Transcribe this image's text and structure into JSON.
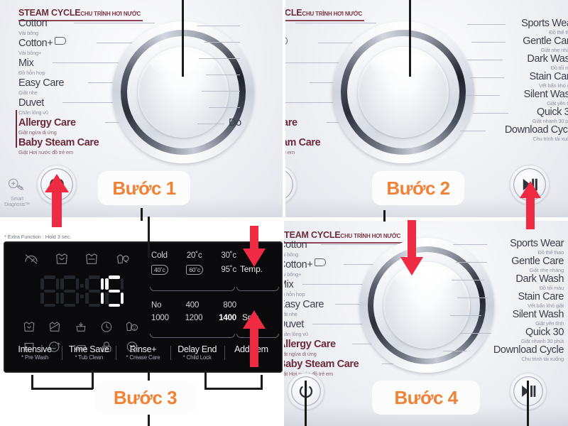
{
  "meta": {
    "subject": "LG front-load washing machine control panel tutorial",
    "accent_orange": "#f08236",
    "arrow_red": "#ee2b42",
    "line_black": "#1a1a1a",
    "maroon": "#6c2b3a"
  },
  "steam_cycle": {
    "en": "STEAM CYCLE",
    "vi": "CHU TRÌNH HƠI NƯỚC"
  },
  "programs_left": [
    {
      "en": "Cotton",
      "vi": "Vải bông",
      "highlight": false,
      "tag": false
    },
    {
      "en": "Cotton+",
      "vi": "Vải bông+",
      "highlight": false,
      "tag": true
    },
    {
      "en": "Mix",
      "vi": "Đồ hỗn hợp",
      "highlight": false,
      "tag": false
    },
    {
      "en": "Easy Care",
      "vi": "Giặt nhẹ",
      "highlight": false,
      "tag": false
    },
    {
      "en": "Duvet",
      "vi": "Chăn lông vũ",
      "highlight": false,
      "tag": false
    },
    {
      "en": "Allergy Care",
      "vi": "Giặt ngừa dị ứng",
      "highlight": true,
      "tag": false
    },
    {
      "en": "Baby Steam Care",
      "vi": "Giặt Hơi nước đồ trẻ em",
      "highlight": true,
      "tag": false
    }
  ],
  "programs_right": [
    {
      "en": "Sports Wear",
      "vi": "Đồ thể thao"
    },
    {
      "en": "Gentle Care",
      "vi": "Giặt nhẹ nhàng"
    },
    {
      "en": "Dark Wash",
      "vi": "Đồ tối màu"
    },
    {
      "en": "Stain Care",
      "vi": "Vết bẩn khó giặt"
    },
    {
      "en": "Silent Wash",
      "vi": "Giặt yên tĩnh"
    },
    {
      "en": "Quick 30",
      "vi": "Giặt nhanh 30 phút"
    },
    {
      "en": "Download Cycle",
      "vi": "Chu trình tải xuống"
    }
  ],
  "smart_diagnosis": {
    "line1": "Smart",
    "line2": "Diagnosis™"
  },
  "buttons": {
    "power_name": "power-button",
    "start_pause_name": "start-pause-button"
  },
  "control_panel": {
    "extra_note": "* Extra Function : Hold 3 sec.",
    "display_value": "15",
    "display_digits": [
      "1",
      "5"
    ],
    "temp": {
      "label": "Temp.",
      "options": [
        {
          "text": "Cold",
          "boxed": false,
          "selected": false
        },
        {
          "text": "20˚c",
          "boxed": false,
          "selected": false
        },
        {
          "text": "30˚c",
          "boxed": false,
          "selected": false
        },
        {
          "text": "40˚c",
          "boxed": true,
          "selected": false
        },
        {
          "text": "60˚c",
          "boxed": true,
          "selected": false
        },
        {
          "text": "95˚c",
          "boxed": false,
          "selected": false
        }
      ]
    },
    "spin": {
      "label": "Spin",
      "options": [
        {
          "text": "No",
          "selected": false
        },
        {
          "text": "400",
          "selected": false
        },
        {
          "text": "800",
          "selected": false
        },
        {
          "text": "1000",
          "selected": false
        },
        {
          "text": "1200",
          "selected": false
        },
        {
          "text": "1400",
          "selected": true
        }
      ]
    },
    "function_buttons": [
      {
        "main": "Intensive",
        "extra": "* Pre Wash"
      },
      {
        "main": "Time Save",
        "extra": "* Tub Clean"
      },
      {
        "main": "Rinse+",
        "extra": "* Crease Care"
      },
      {
        "main": "Delay End",
        "extra": "* Child Lock"
      },
      {
        "main": "Add Item",
        "extra": ""
      }
    ]
  },
  "steps": [
    {
      "label": "Bước 1"
    },
    {
      "label": "Bước 2"
    },
    {
      "label": "Bước 3"
    },
    {
      "label": "Bước 4"
    }
  ]
}
